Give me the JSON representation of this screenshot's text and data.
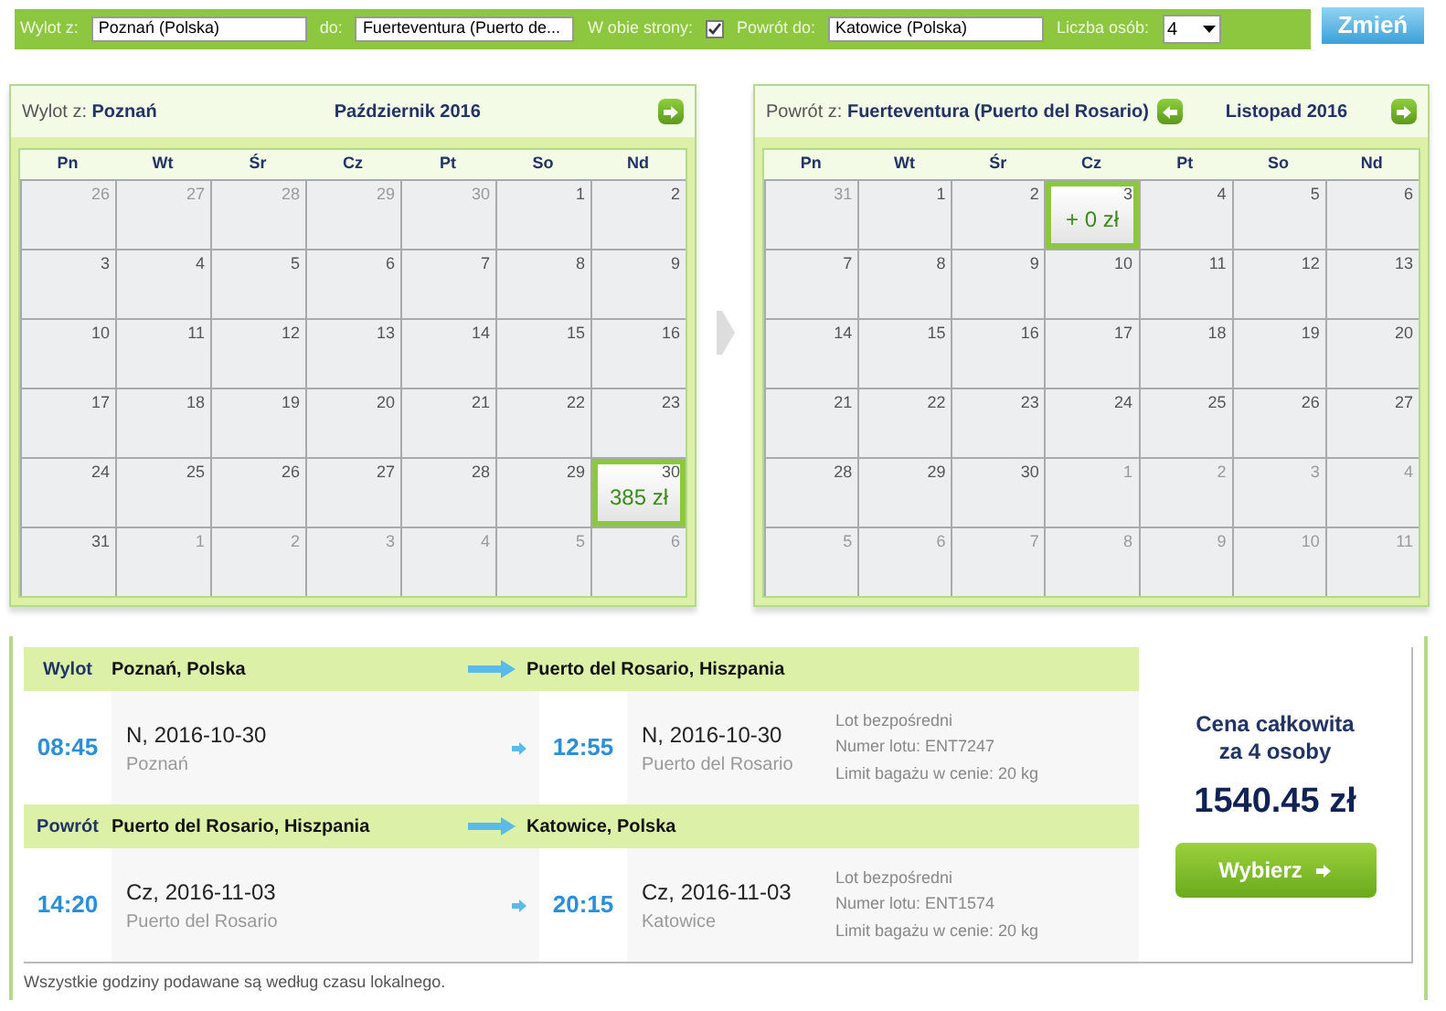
{
  "search_bar": {
    "from_label": "Wylot z:",
    "from_value": "Poznań (Polska)",
    "to_label": "do:",
    "to_value": "Fuerteventura (Puerto de...",
    "round_trip_label": "W obie strony:",
    "round_trip_checked": true,
    "return_label": "Powrót do:",
    "return_value": "Katowice (Polska)",
    "persons_label": "Liczba osób:",
    "persons_value": "4",
    "submit": "Zmień"
  },
  "calendars": [
    {
      "title_label": "Wylot z:",
      "title_value": "Poznań",
      "month": "Październik 2016",
      "prev": false,
      "next": true,
      "weekdays": [
        "Pn",
        "Wt",
        "Śr",
        "Cz",
        "Pt",
        "So",
        "Nd"
      ],
      "days": [
        {
          "day": "26",
          "other_month": true,
          "selected": false
        },
        {
          "day": "27",
          "other_month": true,
          "selected": false
        },
        {
          "day": "28",
          "other_month": true,
          "selected": false
        },
        {
          "day": "29",
          "other_month": true,
          "selected": false
        },
        {
          "day": "30",
          "other_month": true,
          "selected": false
        },
        {
          "day": "1",
          "other_month": false,
          "selected": false
        },
        {
          "day": "2",
          "other_month": false,
          "selected": false
        },
        {
          "day": "3",
          "other_month": false,
          "selected": false
        },
        {
          "day": "4",
          "other_month": false,
          "selected": false
        },
        {
          "day": "5",
          "other_month": false,
          "selected": false
        },
        {
          "day": "6",
          "other_month": false,
          "selected": false
        },
        {
          "day": "7",
          "other_month": false,
          "selected": false
        },
        {
          "day": "8",
          "other_month": false,
          "selected": false
        },
        {
          "day": "9",
          "other_month": false,
          "selected": false
        },
        {
          "day": "10",
          "other_month": false,
          "selected": false
        },
        {
          "day": "11",
          "other_month": false,
          "selected": false
        },
        {
          "day": "12",
          "other_month": false,
          "selected": false
        },
        {
          "day": "13",
          "other_month": false,
          "selected": false
        },
        {
          "day": "14",
          "other_month": false,
          "selected": false
        },
        {
          "day": "15",
          "other_month": false,
          "selected": false
        },
        {
          "day": "16",
          "other_month": false,
          "selected": false
        },
        {
          "day": "17",
          "other_month": false,
          "selected": false
        },
        {
          "day": "18",
          "other_month": false,
          "selected": false
        },
        {
          "day": "19",
          "other_month": false,
          "selected": false
        },
        {
          "day": "20",
          "other_month": false,
          "selected": false
        },
        {
          "day": "21",
          "other_month": false,
          "selected": false
        },
        {
          "day": "22",
          "other_month": false,
          "selected": false
        },
        {
          "day": "23",
          "other_month": false,
          "selected": false
        },
        {
          "day": "24",
          "other_month": false,
          "selected": false
        },
        {
          "day": "25",
          "other_month": false,
          "selected": false
        },
        {
          "day": "26",
          "other_month": false,
          "selected": false
        },
        {
          "day": "27",
          "other_month": false,
          "selected": false
        },
        {
          "day": "28",
          "other_month": false,
          "selected": false
        },
        {
          "day": "29",
          "other_month": false,
          "selected": false
        },
        {
          "day": "30",
          "other_month": false,
          "selected": true,
          "price": "385 zł"
        },
        {
          "day": "31",
          "other_month": false,
          "selected": false
        },
        {
          "day": "1",
          "other_month": true,
          "selected": false
        },
        {
          "day": "2",
          "other_month": true,
          "selected": false
        },
        {
          "day": "3",
          "other_month": true,
          "selected": false
        },
        {
          "day": "4",
          "other_month": true,
          "selected": false
        },
        {
          "day": "5",
          "other_month": true,
          "selected": false
        },
        {
          "day": "6",
          "other_month": true,
          "selected": false
        }
      ]
    },
    {
      "title_label": "Powrót z:",
      "title_value": "Fuerteventura (Puerto del Rosario)",
      "month": "Listopad 2016",
      "prev": true,
      "next": true,
      "weekdays": [
        "Pn",
        "Wt",
        "Śr",
        "Cz",
        "Pt",
        "So",
        "Nd"
      ],
      "days": [
        {
          "day": "31",
          "other_month": true,
          "selected": false
        },
        {
          "day": "1",
          "other_month": false,
          "selected": false
        },
        {
          "day": "2",
          "other_month": false,
          "selected": false
        },
        {
          "day": "3",
          "other_month": false,
          "selected": true,
          "price": "+ 0 zł"
        },
        {
          "day": "4",
          "other_month": false,
          "selected": false
        },
        {
          "day": "5",
          "other_month": false,
          "selected": false
        },
        {
          "day": "6",
          "other_month": false,
          "selected": false
        },
        {
          "day": "7",
          "other_month": false,
          "selected": false
        },
        {
          "day": "8",
          "other_month": false,
          "selected": false
        },
        {
          "day": "9",
          "other_month": false,
          "selected": false
        },
        {
          "day": "10",
          "other_month": false,
          "selected": false
        },
        {
          "day": "11",
          "other_month": false,
          "selected": false
        },
        {
          "day": "12",
          "other_month": false,
          "selected": false
        },
        {
          "day": "13",
          "other_month": false,
          "selected": false
        },
        {
          "day": "14",
          "other_month": false,
          "selected": false
        },
        {
          "day": "15",
          "other_month": false,
          "selected": false
        },
        {
          "day": "16",
          "other_month": false,
          "selected": false
        },
        {
          "day": "17",
          "other_month": false,
          "selected": false
        },
        {
          "day": "18",
          "other_month": false,
          "selected": false
        },
        {
          "day": "19",
          "other_month": false,
          "selected": false
        },
        {
          "day": "20",
          "other_month": false,
          "selected": false
        },
        {
          "day": "21",
          "other_month": false,
          "selected": false
        },
        {
          "day": "22",
          "other_month": false,
          "selected": false
        },
        {
          "day": "23",
          "other_month": false,
          "selected": false
        },
        {
          "day": "24",
          "other_month": false,
          "selected": false
        },
        {
          "day": "25",
          "other_month": false,
          "selected": false
        },
        {
          "day": "26",
          "other_month": false,
          "selected": false
        },
        {
          "day": "27",
          "other_month": false,
          "selected": false
        },
        {
          "day": "28",
          "other_month": false,
          "selected": false
        },
        {
          "day": "29",
          "other_month": false,
          "selected": false
        },
        {
          "day": "30",
          "other_month": false,
          "selected": false
        },
        {
          "day": "1",
          "other_month": true,
          "selected": false
        },
        {
          "day": "2",
          "other_month": true,
          "selected": false
        },
        {
          "day": "3",
          "other_month": true,
          "selected": false
        },
        {
          "day": "4",
          "other_month": true,
          "selected": false
        },
        {
          "day": "5",
          "other_month": true,
          "selected": false
        },
        {
          "day": "6",
          "other_month": true,
          "selected": false
        },
        {
          "day": "7",
          "other_month": true,
          "selected": false
        },
        {
          "day": "8",
          "other_month": true,
          "selected": false
        },
        {
          "day": "9",
          "other_month": true,
          "selected": false
        },
        {
          "day": "10",
          "other_month": true,
          "selected": false
        },
        {
          "day": "11",
          "other_month": true,
          "selected": false
        }
      ]
    }
  ],
  "legs": [
    {
      "label": "Wylot",
      "from": "Poznań, Polska",
      "to": "Puerto del Rosario, Hiszpania",
      "dep_time": "08:45",
      "dep_date": "N, 2016-10-30",
      "dep_city": "Poznań",
      "arr_time": "12:55",
      "arr_date": "N, 2016-10-30",
      "arr_city": "Puerto del Rosario",
      "info": [
        "Lot bezpośredni",
        "Numer lotu: ENT7247",
        "Limit bagażu w cenie: 20 kg"
      ]
    },
    {
      "label": "Powrót",
      "from": "Puerto del Rosario, Hiszpania",
      "to": "Katowice, Polska",
      "dep_time": "14:20",
      "dep_date": "Cz, 2016-11-03",
      "dep_city": "Puerto del Rosario",
      "arr_time": "20:15",
      "arr_date": "Cz, 2016-11-03",
      "arr_city": "Katowice",
      "info": [
        "Lot bezpośredni",
        "Numer lotu: ENT1574",
        "Limit bagażu w cenie: 20 kg"
      ]
    }
  ],
  "price": {
    "caption": "Cena całkowita za 4 osoby",
    "total": "1540.45 zł",
    "button": "Wybierz"
  },
  "footnote": "Wszystkie godziny podawane są według czasu lokalnego."
}
